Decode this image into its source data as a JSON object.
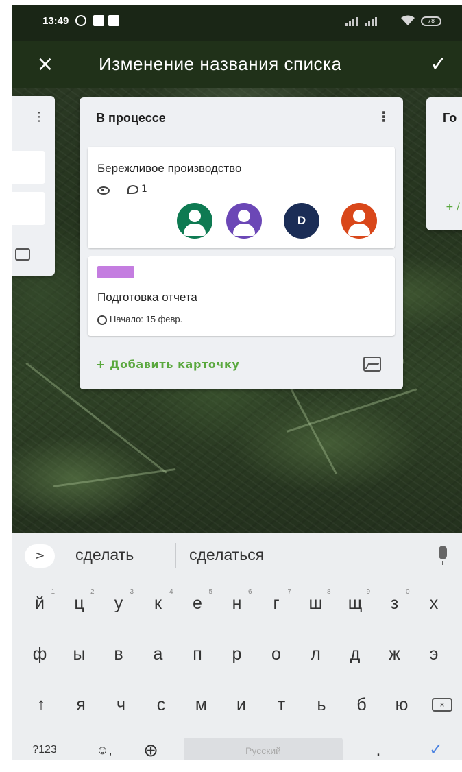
{
  "status_bar": {
    "time": "13:49",
    "battery": "78"
  },
  "toolbar": {
    "close_icon": "×",
    "title": "Изменение названия списка",
    "confirm_icon": "✓"
  },
  "board": {
    "lists": [
      {
        "title": "В процессе",
        "menu_icon": "⋮",
        "cards": [
          {
            "title": "Бережливое производство",
            "comments": "1",
            "members": [
              {
                "type": "avatar-icon",
                "color": "#0e7a52"
              },
              {
                "type": "avatar-icon",
                "color": "#6b47b6"
              },
              {
                "type": "initial",
                "initial": "D",
                "color": "#1b2d56"
              },
              {
                "type": "avatar-icon",
                "color": "#d9471a"
              }
            ]
          },
          {
            "label_color": "#c47de0",
            "title": "Подготовка отчета",
            "start": "Начало: 15 февр."
          }
        ],
        "add_card_label": "+ Добавить карточку"
      },
      {
        "title": "Го",
        "add_label": "+ /"
      }
    ],
    "partial_left_list": {
      "menu_icon": "⋮"
    }
  },
  "keyboard": {
    "suggestions": [
      "сделать",
      "сделаться"
    ],
    "expand_label": ">",
    "row1": [
      "й",
      "ц",
      "у",
      "к",
      "е",
      "н",
      "г",
      "ш",
      "щ",
      "з",
      "х"
    ],
    "row1_hints": [
      "1",
      "2",
      "3",
      "4",
      "5",
      "6",
      "7",
      "8",
      "9",
      "0",
      ""
    ],
    "row2": [
      "ф",
      "ы",
      "в",
      "а",
      "п",
      "р",
      "о",
      "л",
      "д",
      "ж",
      "э"
    ],
    "row3": [
      "я",
      "ч",
      "с",
      "м",
      "и",
      "т",
      "ь",
      "б",
      "ю"
    ],
    "shift_label": "↑",
    "backspace_label": "×",
    "num_label": "?123",
    "emoji_label": "☺,",
    "globe_label": "⊕",
    "space_label": "Русский",
    "period_label": ".",
    "enter_label": "✓"
  },
  "colors": {
    "toolbar_bg": "#203119",
    "accent_green": "#5aa83e",
    "enter_blue": "#4b82e0"
  }
}
